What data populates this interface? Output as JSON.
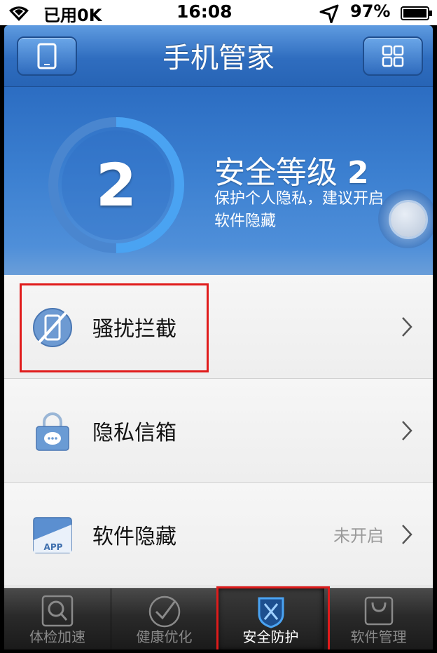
{
  "status_bar": {
    "data_used": "已用0K",
    "time": "16:08",
    "battery_percent": "97%"
  },
  "header": {
    "title": "手机管家",
    "left_icon": "phone-icon",
    "right_icon": "grid-icon"
  },
  "hero": {
    "level_number": "2",
    "level_title": "安全等级",
    "level_value": "2",
    "description": "保护个人隐私，建议开启软件隐藏",
    "ring_progress": 0.5
  },
  "list": {
    "items": [
      {
        "label": "骚扰拦截",
        "icon": "blocked-phone-icon",
        "status": ""
      },
      {
        "label": "隐私信箱",
        "icon": "lock-message-icon",
        "status": ""
      },
      {
        "label": "软件隐藏",
        "icon": "app-hide-icon",
        "status": "未开启"
      }
    ]
  },
  "tabbar": {
    "tabs": [
      {
        "label": "体检加速",
        "icon": "search-icon"
      },
      {
        "label": "健康优化",
        "icon": "check-circle-icon"
      },
      {
        "label": "安全防护",
        "icon": "shield-icon",
        "active": true
      },
      {
        "label": "软件管理",
        "icon": "bag-icon"
      }
    ]
  },
  "colors": {
    "header_blue": "#2f6dbf",
    "ring_blue": "#4aa3f2",
    "highlight_red": "#e01b1b"
  }
}
